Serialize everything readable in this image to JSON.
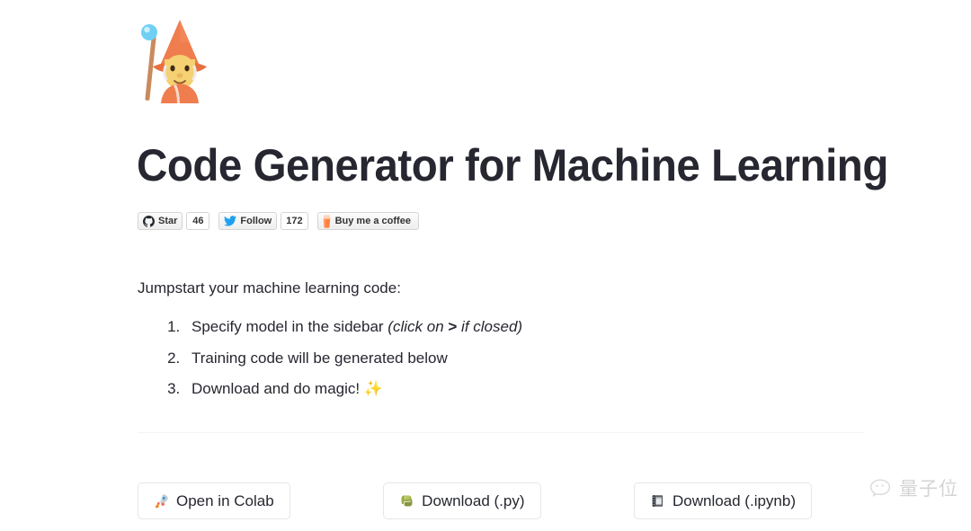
{
  "hero": {
    "emoji_name": "wizard-emoji",
    "emoji_char": "🧙"
  },
  "header": {
    "title": "Code Generator for Machine Learning"
  },
  "badges": {
    "github": {
      "icon": "github-octocat-icon",
      "label": "Star",
      "count": "46"
    },
    "twitter": {
      "icon": "twitter-bird-icon",
      "label": "Follow",
      "count": "172",
      "color": "#1da1f2"
    },
    "coffee": {
      "icon": "coffee-cup-icon",
      "label": "Buy me a coffee",
      "color": "#ff813f"
    }
  },
  "intro": {
    "lead": "Jumpstart your machine learning code:",
    "steps": [
      {
        "text_before": "Specify model in the sidebar ",
        "paren_open": "(click on ",
        "chevron": ">",
        "paren_close": " if closed)"
      },
      {
        "text": "Training code will be generated below"
      },
      {
        "text": "Download and do magic! ",
        "emoji": "✨"
      }
    ]
  },
  "actions": [
    {
      "icon": "rocket-icon",
      "emoji": "🚀",
      "label": "Open in Colab"
    },
    {
      "icon": "python-snake-icon",
      "emoji": "🐍",
      "label": "Download (.py)"
    },
    {
      "icon": "notebook-icon",
      "emoji": "📓",
      "label": "Download (.ipynb)"
    }
  ],
  "watermark": {
    "text": "量子位",
    "logo": "qbitai-logo-icon"
  },
  "theme": {
    "background": "#ffffff",
    "text": "#262730",
    "border": "#e6e6e9",
    "divider": "#f4f4f6"
  }
}
